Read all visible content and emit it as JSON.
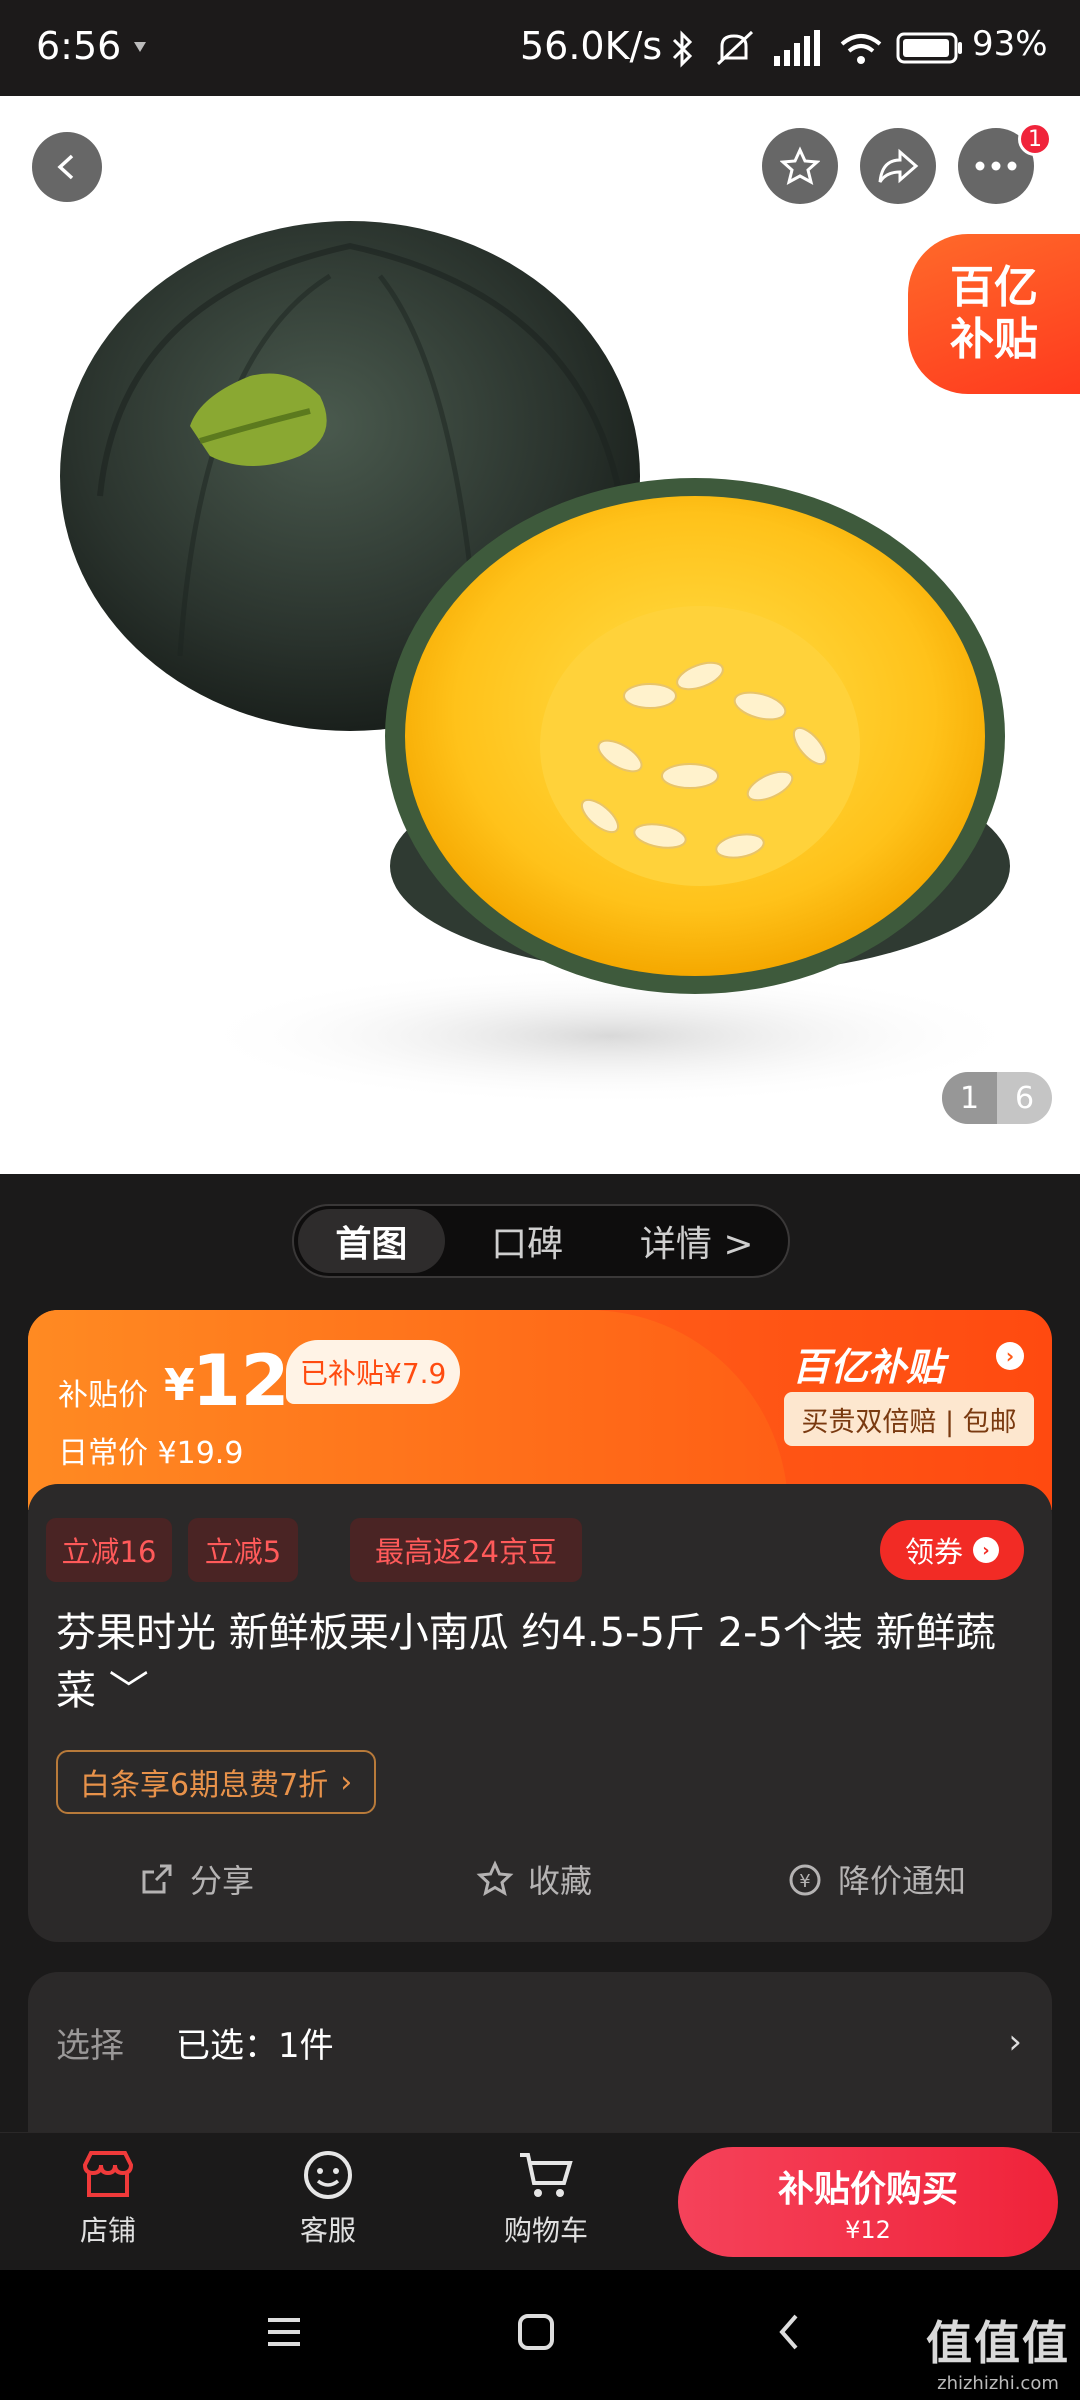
{
  "status_bar": {
    "time": "6:56",
    "net_speed": "56.0K/s",
    "battery": "93%"
  },
  "hero": {
    "notification_count": "1",
    "subsidy_tag_line1": "百亿",
    "subsidy_tag_line2": "补贴",
    "image_index": "1",
    "image_total": "6"
  },
  "tabs": [
    {
      "label": "首图"
    },
    {
      "label": "口碑"
    },
    {
      "label": "详情 >"
    }
  ],
  "price": {
    "label": "补贴价",
    "yen": "¥",
    "value": "12",
    "subsidized": "已补贴¥7.9",
    "daily": "日常价 ¥19.9",
    "brand": "百亿补贴",
    "brand_arrow": "›",
    "guarantee": "买贵双倍赔 | 包邮"
  },
  "promos": [
    "立减16",
    "立减5",
    "最高返24京豆"
  ],
  "coupon": {
    "label": "领券",
    "arrow": "›"
  },
  "product_title": "芬果时光 新鲜板栗小南瓜 约4.5-5斤 2-5个装 新鲜蔬菜 ﹀",
  "baitiao": {
    "label": "白条享6期息费7折",
    "arrow": "›"
  },
  "actions": [
    {
      "label": "分享",
      "icon": "share-icon"
    },
    {
      "label": "收藏",
      "icon": "star-icon"
    },
    {
      "label": "降价通知",
      "icon": "price-alert-icon"
    }
  ],
  "selection": {
    "label": "选择",
    "value": "已选：1件",
    "chevron": "›"
  },
  "bottom_bar": {
    "store": "店铺",
    "service": "客服",
    "cart": "购物车",
    "buy_label": "补贴价购买",
    "buy_price": "¥12"
  },
  "watermark": {
    "line1": "值值值",
    "line2": "zhizhizhi.com"
  },
  "colors": {
    "accent": "#ff5a17",
    "buy": "#f0233a",
    "background": "#1b1a1a"
  }
}
